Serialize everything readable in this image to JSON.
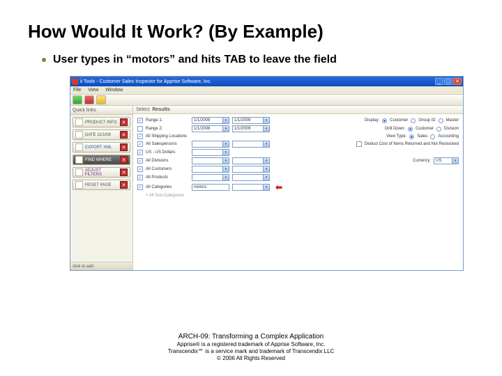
{
  "slide": {
    "title": "How Would It Work? (By Example)",
    "bullet": "User types in “motors” and hits TAB to leave the field"
  },
  "app": {
    "titlebar": "ii Tools - Customer Sales Inspector for Apprise Software, Inc.",
    "menu": [
      "File",
      "View",
      "Window"
    ],
    "sidebar": {
      "header": "Quick links",
      "items": [
        {
          "label": "PRODUCT INFO"
        },
        {
          "label": "DATE 11/1/08"
        },
        {
          "label": "EXPORT XML"
        },
        {
          "label": "FIND WHERE"
        },
        {
          "label": "ADJUST FILTERS"
        },
        {
          "label": "RESET PAGE"
        }
      ],
      "bottom_hint": "click to add"
    },
    "pane_header": {
      "label": "Select",
      "value": "Results"
    },
    "rows": {
      "range1": {
        "label": "Range 1:",
        "from": "1/1/2008",
        "to": "1/1/2009"
      },
      "range2": {
        "label": "Range 2:",
        "from": "1/1/2008",
        "to": "1/1/2009"
      },
      "ship": "All Shipping Locations",
      "salesp": "All Salespersons",
      "curr": "US - US Dollars",
      "div": "All Divisions",
      "cust": "All Customers",
      "prod": "All Products",
      "cat": "All Categories",
      "typed": "motors",
      "sub": "+ All Sub-Categories"
    },
    "right": {
      "display": {
        "label": "Display:",
        "opts": [
          "Customer",
          "Group ID",
          "Master"
        ]
      },
      "drill": {
        "label": "Drill Down:",
        "opts": [
          "Customer",
          "Division"
        ]
      },
      "view": {
        "label": "View Type:",
        "opts": [
          "Sales",
          "Accounting"
        ]
      },
      "deduct": "Deduct Cost of Items Returned and Not Restocked",
      "currency": {
        "label": "Currency:",
        "value": "US"
      }
    }
  },
  "footer": {
    "l1": "ARCH-09:  Transforming a Complex Application",
    "l2": "Apprise® is a registered trademark of Apprise Software, Inc.",
    "l3": "Transcendix℠ is a service mark and trademark of Transcendix LLC",
    "l4": "© 2006 All Rights Reserved"
  }
}
